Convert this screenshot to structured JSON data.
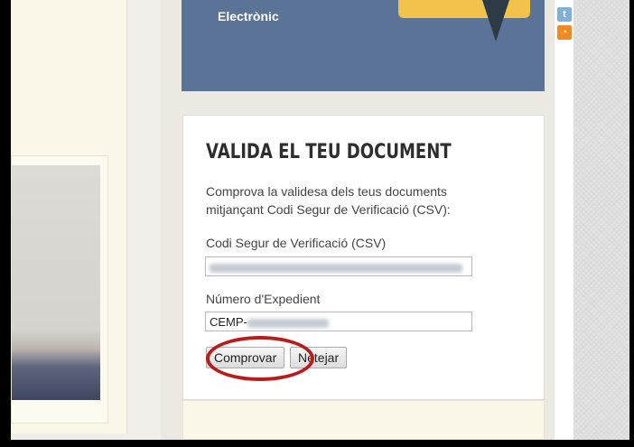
{
  "banner": {
    "text": "Electrònic"
  },
  "validate": {
    "title": "VALIDA EL TEU DOCUMENT",
    "description": "Comprova la validesa dels teus documents mitjançant Codi Segur de Verificació (CSV):",
    "csv_label": "Codi Segur de Verificació (CSV)",
    "expedient_label": "Número d'Expedient",
    "expedient_value": "CEMP-",
    "check_button": "Comprovar",
    "clear_button": "Netejar"
  },
  "social": {
    "icons": [
      "twitter-icon",
      "rss-icon"
    ]
  },
  "colors": {
    "banner": "#5a7397",
    "highlight_circle": "#b91c1c"
  }
}
